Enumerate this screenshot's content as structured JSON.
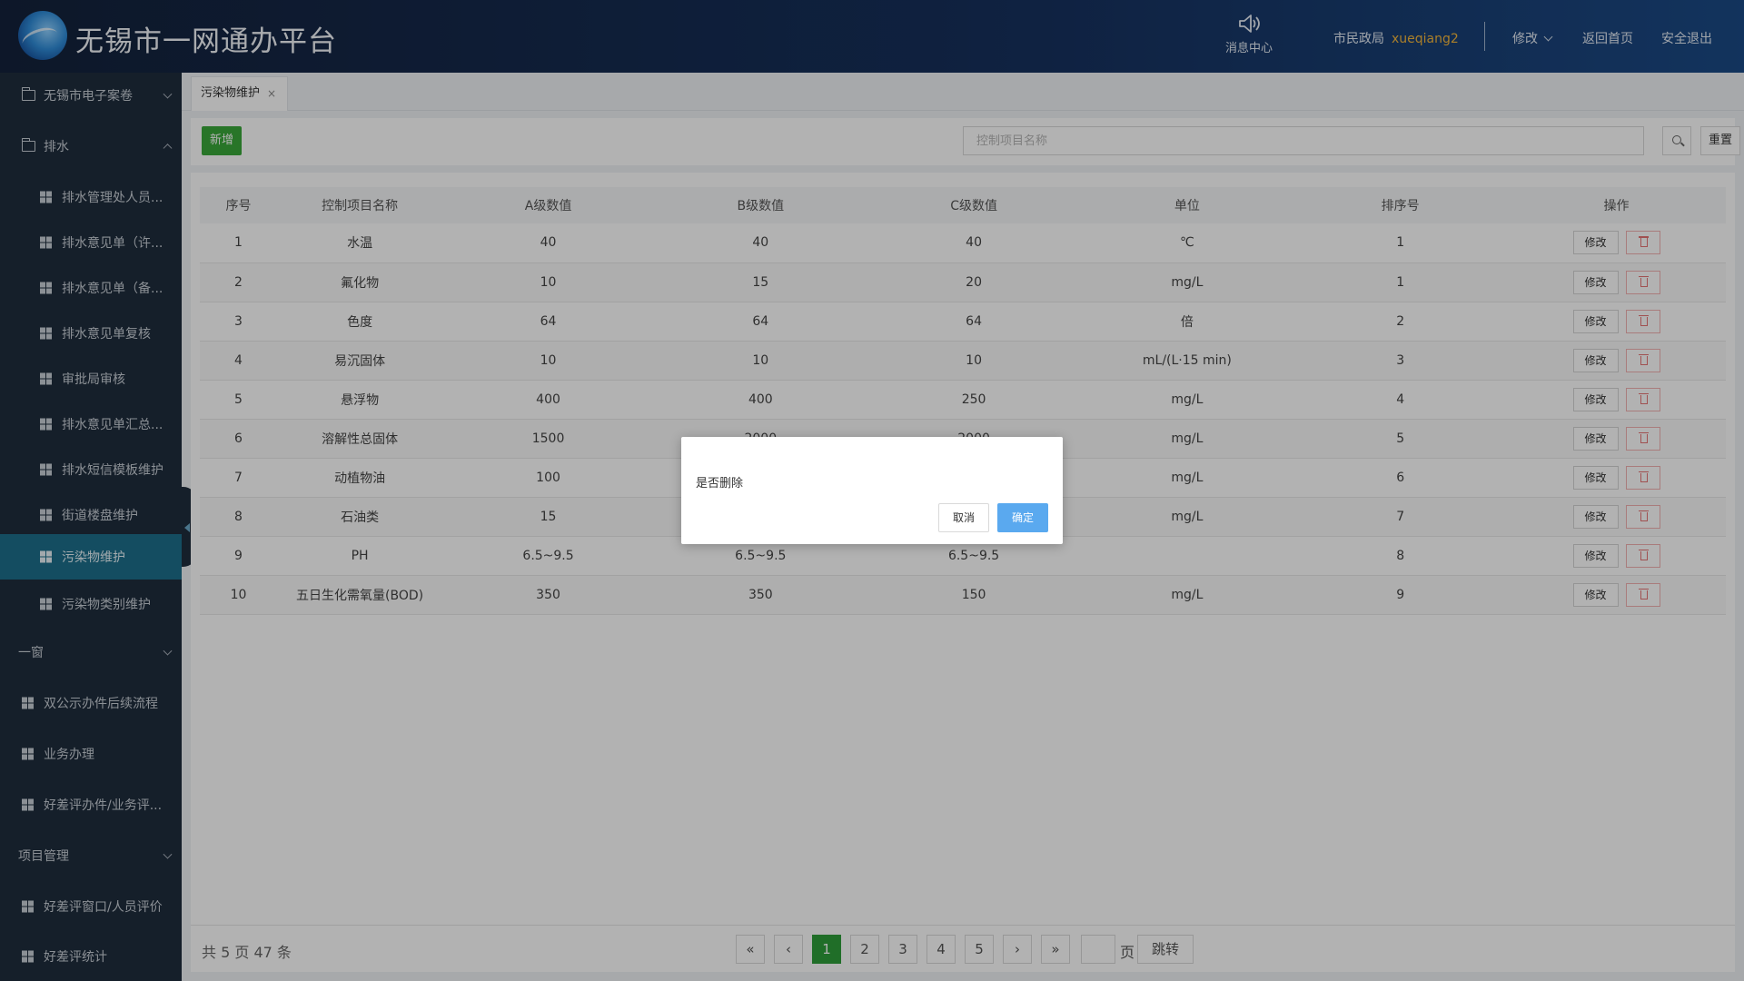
{
  "header": {
    "title": "无锡市一网通办平台",
    "message_center": "消息中心",
    "org": "市民政局",
    "username": "xueqiang2",
    "modify": "修改",
    "home": "返回首页",
    "logout": "安全退出"
  },
  "sidebar": {
    "items": [
      {
        "label": "无锡市电子案卷",
        "type": "group"
      },
      {
        "label": "排水",
        "type": "group"
      },
      {
        "label": "排水管理处人员...",
        "type": "sub"
      },
      {
        "label": "排水意见单（许...",
        "type": "sub"
      },
      {
        "label": "排水意见单（备...",
        "type": "sub"
      },
      {
        "label": "排水意见单复核",
        "type": "sub"
      },
      {
        "label": "审批局审核",
        "type": "sub"
      },
      {
        "label": "排水意见单汇总...",
        "type": "sub"
      },
      {
        "label": "排水短信模板维护",
        "type": "sub"
      },
      {
        "label": "街道楼盘维护",
        "type": "sub"
      },
      {
        "label": "污染物维护",
        "type": "sub",
        "active": true
      },
      {
        "label": "污染物类别维护",
        "type": "sub"
      },
      {
        "label": "一窗",
        "type": "section"
      },
      {
        "label": "双公示办件后续流程",
        "type": "item"
      },
      {
        "label": "业务办理",
        "type": "item"
      },
      {
        "label": "好差评办件/业务评...",
        "type": "item"
      },
      {
        "label": "项目管理",
        "type": "section"
      },
      {
        "label": "好差评窗口/人员评价",
        "type": "item"
      },
      {
        "label": "好差评统计",
        "type": "item"
      }
    ]
  },
  "tabs": [
    {
      "label": "污染物维护",
      "close": "×"
    }
  ],
  "toolbar": {
    "add_label": "新增",
    "search_placeholder": "控制项目名称",
    "reset_label": "重置"
  },
  "table": {
    "headers": [
      "序号",
      "控制项目名称",
      "A级数值",
      "B级数值",
      "C级数值",
      "单位",
      "排序号",
      "操作"
    ],
    "rows": [
      [
        "1",
        "水温",
        "40",
        "40",
        "40",
        "℃",
        "1"
      ],
      [
        "2",
        "氟化物",
        "10",
        "15",
        "20",
        "mg/L",
        "1"
      ],
      [
        "3",
        "色度",
        "64",
        "64",
        "64",
        "倍",
        "2"
      ],
      [
        "4",
        "易沉固体",
        "10",
        "10",
        "10",
        "mL/(L·15 min)",
        "3"
      ],
      [
        "5",
        "悬浮物",
        "400",
        "400",
        "250",
        "mg/L",
        "4"
      ],
      [
        "6",
        "溶解性总固体",
        "1500",
        "2000",
        "2000",
        "mg/L",
        "5"
      ],
      [
        "7",
        "动植物油",
        "100",
        "",
        "",
        "mg/L",
        "6"
      ],
      [
        "8",
        "石油类",
        "15",
        "",
        "",
        "mg/L",
        "7"
      ],
      [
        "9",
        "PH",
        "6.5~9.5",
        "6.5~9.5",
        "6.5~9.5",
        "",
        "8"
      ],
      [
        "10",
        "五日生化需氧量(BOD)",
        "350",
        "350",
        "150",
        "mg/L",
        "9"
      ]
    ],
    "edit_label": "修改"
  },
  "pagination": {
    "total_text": "共 5 页 47 条",
    "first": "«",
    "prev": "‹",
    "pages": [
      "1",
      "2",
      "3",
      "4",
      "5"
    ],
    "current_page": 1,
    "next": "›",
    "last": "»",
    "page_unit": "页",
    "go_label": "跳转"
  },
  "dialog": {
    "message": "是否删除",
    "cancel": "取消",
    "confirm": "确定"
  },
  "colors": {
    "header_bg": "#16315e",
    "sidebar_bg": "#1f2d3d",
    "active_item": "#1d6f8c",
    "primary_green": "#3aa83a",
    "username_accent": "#f4b73c",
    "confirm_blue": "#5aa9ef",
    "delete_red": "#e57373"
  }
}
